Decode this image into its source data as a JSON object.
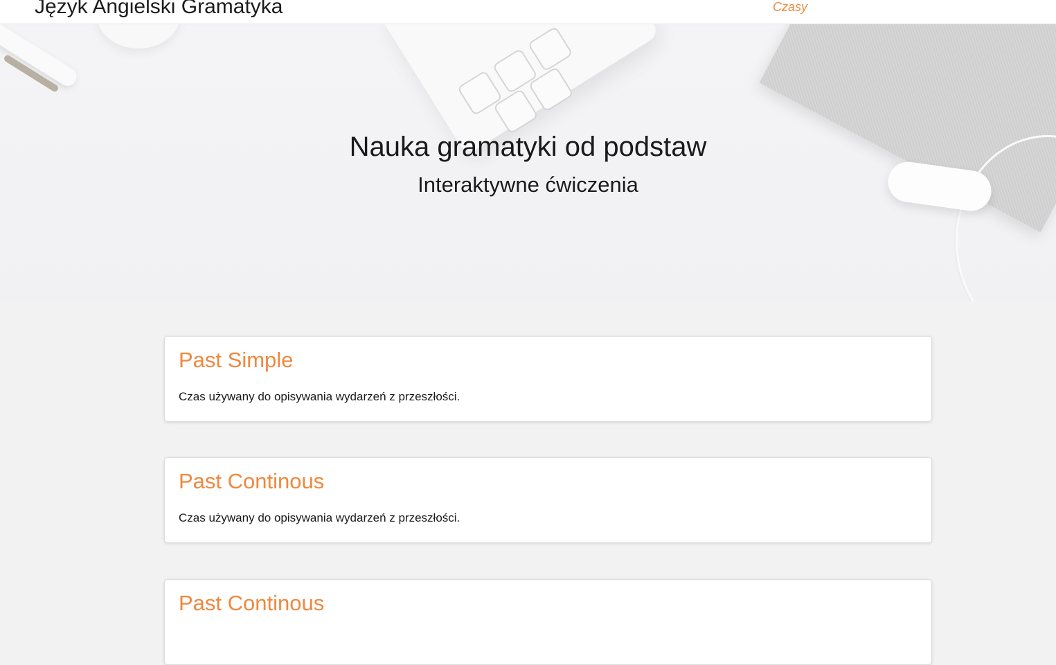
{
  "navbar": {
    "brand": "Język Angielski Gramatyka",
    "links": [
      {
        "label": "Czasy"
      }
    ]
  },
  "hero": {
    "title": "Nauka gramatyki od podstaw",
    "subtitle": "Interaktywne ćwiczenia"
  },
  "cards": [
    {
      "title": "Past Simple",
      "text": "Czas używany do opisywania wydarzeń z przeszłości."
    },
    {
      "title": "Past Continous",
      "text": "Czas używany do opisywania wydarzeń z przeszłości."
    },
    {
      "title": "Past Continous",
      "text": ""
    }
  ],
  "colors": {
    "accent": "#f0883e",
    "page_background": "#f2f2f2",
    "card_background": "#ffffff",
    "text": "#1a1a1a"
  }
}
